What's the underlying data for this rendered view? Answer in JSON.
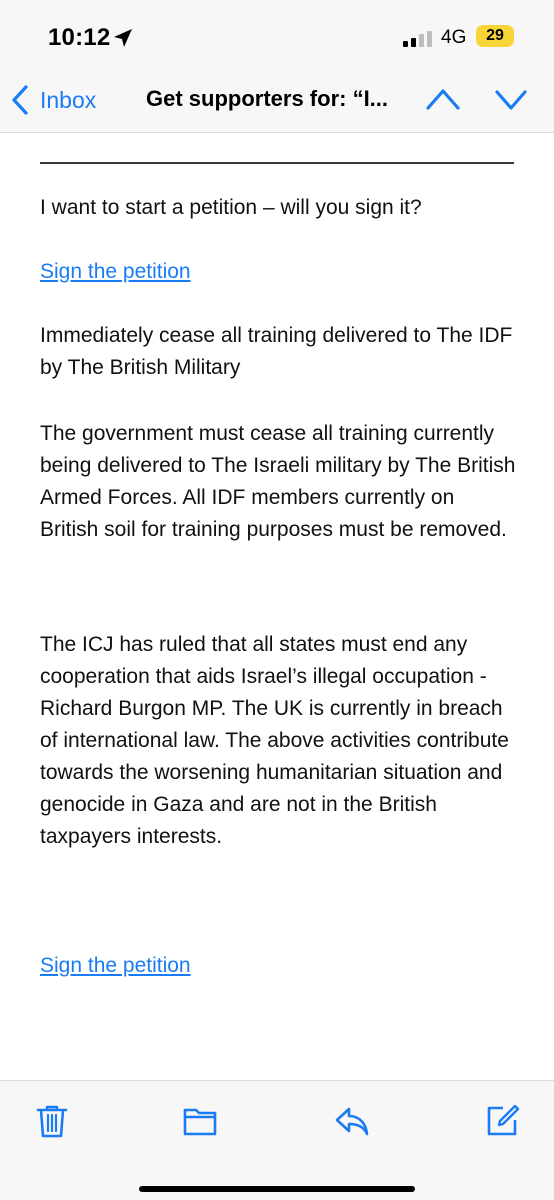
{
  "status_bar": {
    "time": "10:12",
    "network": "4G",
    "battery": "29"
  },
  "nav": {
    "back_label": "Inbox",
    "title": "Get supporters for: “I..."
  },
  "email": {
    "intro": "I want to start a petition – will you sign it?",
    "link_top": "Sign the petition",
    "petition_title": "Immediately cease all training delivered to The IDF by The British Military",
    "body_1": "The government must cease all training currently being delivered to The Israeli military by The British Armed Forces. All IDF members currently on British soil for training purposes must be removed.",
    "body_2": "The ICJ has ruled that all states must end any cooperation that aids Israel’s illegal occupation - Richard Burgon MP. The UK is currently in breach of international law. The above activities contribute towards the worsening humanitarian situation and genocide in Gaza and are not in the British taxpayers interests.",
    "link_bottom": "Sign the petition"
  },
  "colors": {
    "accent": "#1a7cf5",
    "battery": "#f7d539",
    "bar_background": "#f7f7f7"
  },
  "icons": {
    "location": "location-arrow-icon",
    "signal": "signal-bars-icon",
    "back": "chevron-left-icon",
    "up": "chevron-up-icon",
    "down": "chevron-down-icon",
    "trash": "trash-icon",
    "folder": "folder-icon",
    "reply": "reply-icon",
    "compose": "compose-icon"
  }
}
